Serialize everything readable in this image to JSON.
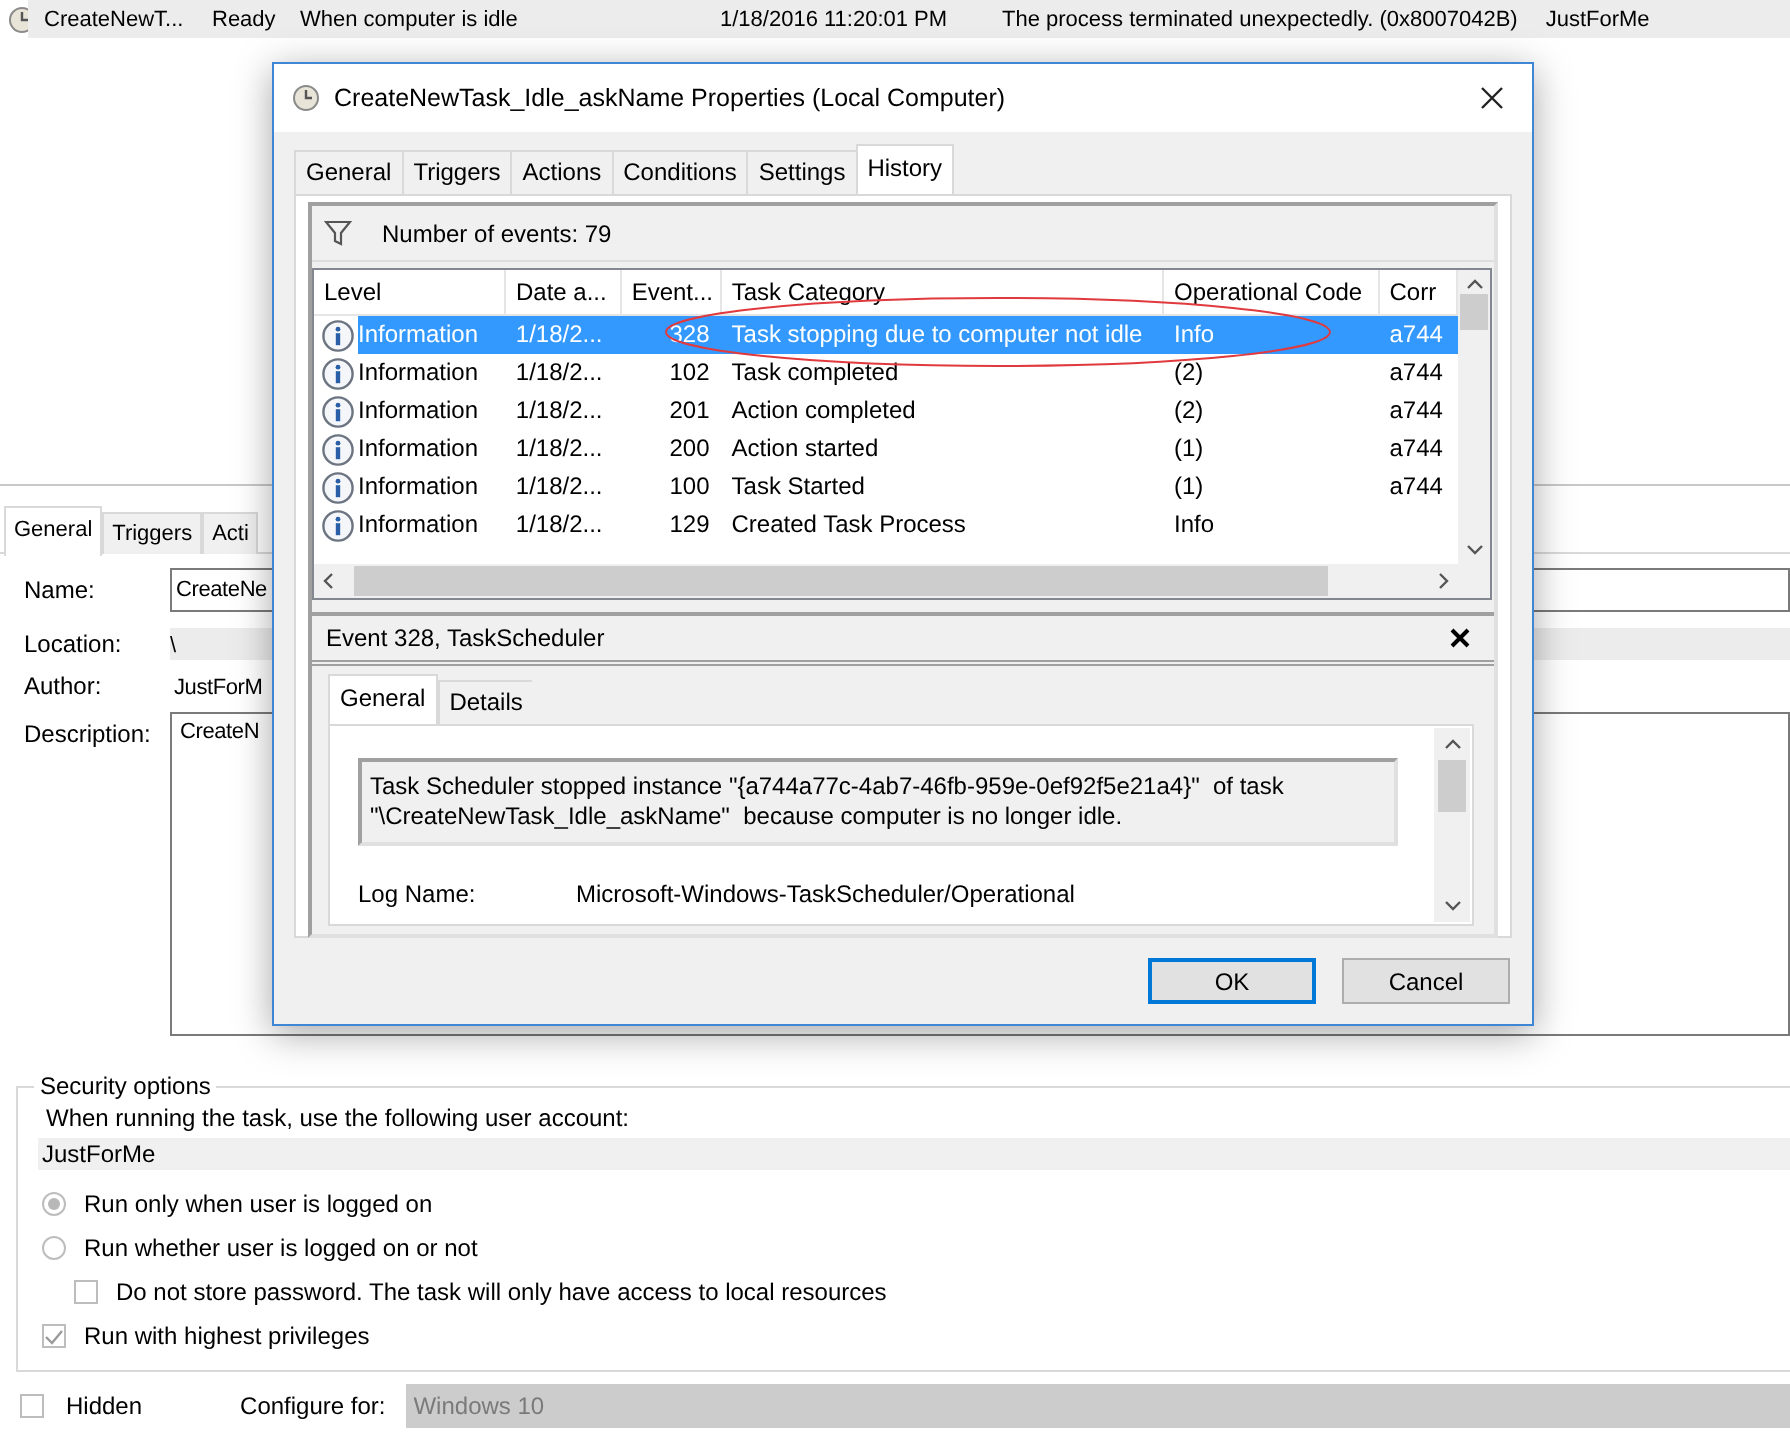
{
  "task_row": {
    "name": "CreateNewT...",
    "status": "Ready",
    "trigger": "When computer is idle",
    "last_run": "1/18/2016 11:20:01 PM",
    "last_result": "The process terminated unexpectedly. (0x8007042B)",
    "author": "JustForMe"
  },
  "properties": {
    "tabs": [
      {
        "label": "General",
        "selected": true
      },
      {
        "label": "Triggers",
        "selected": false
      },
      {
        "label": "Acti",
        "selected": false
      }
    ],
    "fields": [
      {
        "kind": "textbox",
        "label": "Name:",
        "value": "CreateNe"
      },
      {
        "kind": "readonly",
        "label": "Location:",
        "value": "\\"
      },
      {
        "kind": "plain",
        "label": "Author:",
        "value": "JustForM"
      },
      {
        "kind": "textarea",
        "label": "Description:",
        "value": "CreateN"
      }
    ],
    "security_options": {
      "title": "Security options",
      "account_prompt": "When running the task, use the following user account:",
      "account": "JustForMe",
      "options": [
        {
          "kind": "radio",
          "label": "Run only when user is logged on",
          "checked": true
        },
        {
          "kind": "radio",
          "label": "Run whether user is logged on or not",
          "checked": false,
          "children": [
            {
              "kind": "checkbox",
              "label": "Do not store password.  The task will only have access to local resources",
              "checked": false
            }
          ]
        },
        {
          "kind": "checkbox",
          "label": "Run with highest privileges",
          "checked": true
        }
      ]
    },
    "hidden": {
      "label": "Hidden",
      "checked": false
    },
    "configure_for": {
      "label": "Configure for:",
      "value": "Windows 10"
    }
  },
  "dialog": {
    "title": "CreateNewTask_Idle_askName Properties (Local Computer)",
    "tabs": [
      {
        "label": "General",
        "selected": false
      },
      {
        "label": "Triggers",
        "selected": false
      },
      {
        "label": "Actions",
        "selected": false
      },
      {
        "label": "Conditions",
        "selected": false
      },
      {
        "label": "Settings",
        "selected": false
      },
      {
        "label": "History",
        "selected": true
      }
    ],
    "history": {
      "event_count": "Number of events: 79",
      "columns": [
        "Level",
        "Date a...",
        "Event...",
        "Task Category",
        "Operational Code",
        "Corr"
      ],
      "rows": [
        {
          "level": "Information",
          "date": "1/18/2...",
          "event_id": "328",
          "category": "Task stopping due to computer not idle",
          "op_code": "Info",
          "correlation": "a744",
          "selected": true
        },
        {
          "level": "Information",
          "date": "1/18/2...",
          "event_id": "102",
          "category": "Task completed",
          "op_code": "(2)",
          "correlation": "a744",
          "selected": false
        },
        {
          "level": "Information",
          "date": "1/18/2...",
          "event_id": "201",
          "category": "Action completed",
          "op_code": "(2)",
          "correlation": "a744",
          "selected": false
        },
        {
          "level": "Information",
          "date": "1/18/2...",
          "event_id": "200",
          "category": "Action started",
          "op_code": "(1)",
          "correlation": "a744",
          "selected": false
        },
        {
          "level": "Information",
          "date": "1/18/2...",
          "event_id": "100",
          "category": "Task Started",
          "op_code": "(1)",
          "correlation": "a744",
          "selected": false
        },
        {
          "level": "Information",
          "date": "1/18/2...",
          "event_id": "129",
          "category": "Created Task Process",
          "op_code": "Info",
          "selected": false
        }
      ]
    },
    "event_detail": {
      "title": "Event 328, TaskScheduler",
      "tabs": [
        {
          "label": "General",
          "selected": true
        },
        {
          "label": "Details",
          "selected": false
        }
      ],
      "message": "Task Scheduler stopped instance \"{a744a77c-4ab7-46fb-959e-0ef92f5e21a4}\"  of task\n\"\\CreateNewTask_Idle_askName\"  because computer is no longer idle.",
      "log_name_label": "Log Name:",
      "log_name": "Microsoft-Windows-TaskScheduler/Operational"
    },
    "buttons": [
      {
        "label": "OK",
        "default": true
      },
      {
        "label": "Cancel",
        "default": false
      }
    ]
  }
}
